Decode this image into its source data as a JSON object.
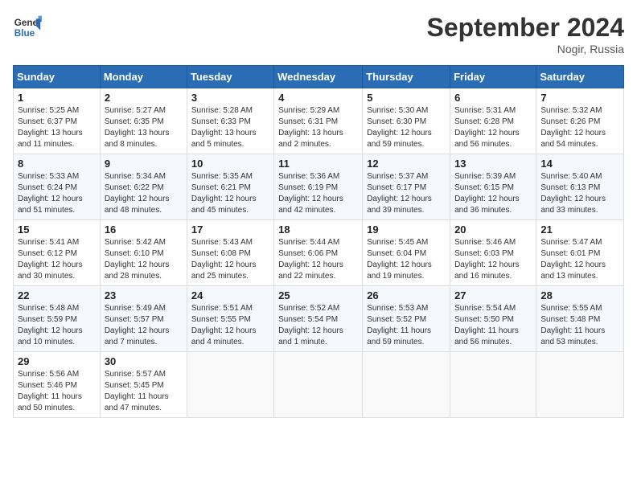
{
  "header": {
    "logo_line1": "General",
    "logo_line2": "Blue",
    "month": "September 2024",
    "location": "Nogir, Russia"
  },
  "weekdays": [
    "Sunday",
    "Monday",
    "Tuesday",
    "Wednesday",
    "Thursday",
    "Friday",
    "Saturday"
  ],
  "weeks": [
    [
      {
        "day": 1,
        "sunrise": "5:25 AM",
        "sunset": "6:37 PM",
        "daylight": "13 hours and 11 minutes."
      },
      {
        "day": 2,
        "sunrise": "5:27 AM",
        "sunset": "6:35 PM",
        "daylight": "13 hours and 8 minutes."
      },
      {
        "day": 3,
        "sunrise": "5:28 AM",
        "sunset": "6:33 PM",
        "daylight": "13 hours and 5 minutes."
      },
      {
        "day": 4,
        "sunrise": "5:29 AM",
        "sunset": "6:31 PM",
        "daylight": "13 hours and 2 minutes."
      },
      {
        "day": 5,
        "sunrise": "5:30 AM",
        "sunset": "6:30 PM",
        "daylight": "12 hours and 59 minutes."
      },
      {
        "day": 6,
        "sunrise": "5:31 AM",
        "sunset": "6:28 PM",
        "daylight": "12 hours and 56 minutes."
      },
      {
        "day": 7,
        "sunrise": "5:32 AM",
        "sunset": "6:26 PM",
        "daylight": "12 hours and 54 minutes."
      }
    ],
    [
      {
        "day": 8,
        "sunrise": "5:33 AM",
        "sunset": "6:24 PM",
        "daylight": "12 hours and 51 minutes."
      },
      {
        "day": 9,
        "sunrise": "5:34 AM",
        "sunset": "6:22 PM",
        "daylight": "12 hours and 48 minutes."
      },
      {
        "day": 10,
        "sunrise": "5:35 AM",
        "sunset": "6:21 PM",
        "daylight": "12 hours and 45 minutes."
      },
      {
        "day": 11,
        "sunrise": "5:36 AM",
        "sunset": "6:19 PM",
        "daylight": "12 hours and 42 minutes."
      },
      {
        "day": 12,
        "sunrise": "5:37 AM",
        "sunset": "6:17 PM",
        "daylight": "12 hours and 39 minutes."
      },
      {
        "day": 13,
        "sunrise": "5:39 AM",
        "sunset": "6:15 PM",
        "daylight": "12 hours and 36 minutes."
      },
      {
        "day": 14,
        "sunrise": "5:40 AM",
        "sunset": "6:13 PM",
        "daylight": "12 hours and 33 minutes."
      }
    ],
    [
      {
        "day": 15,
        "sunrise": "5:41 AM",
        "sunset": "6:12 PM",
        "daylight": "12 hours and 30 minutes."
      },
      {
        "day": 16,
        "sunrise": "5:42 AM",
        "sunset": "6:10 PM",
        "daylight": "12 hours and 28 minutes."
      },
      {
        "day": 17,
        "sunrise": "5:43 AM",
        "sunset": "6:08 PM",
        "daylight": "12 hours and 25 minutes."
      },
      {
        "day": 18,
        "sunrise": "5:44 AM",
        "sunset": "6:06 PM",
        "daylight": "12 hours and 22 minutes."
      },
      {
        "day": 19,
        "sunrise": "5:45 AM",
        "sunset": "6:04 PM",
        "daylight": "12 hours and 19 minutes."
      },
      {
        "day": 20,
        "sunrise": "5:46 AM",
        "sunset": "6:03 PM",
        "daylight": "12 hours and 16 minutes."
      },
      {
        "day": 21,
        "sunrise": "5:47 AM",
        "sunset": "6:01 PM",
        "daylight": "12 hours and 13 minutes."
      }
    ],
    [
      {
        "day": 22,
        "sunrise": "5:48 AM",
        "sunset": "5:59 PM",
        "daylight": "12 hours and 10 minutes."
      },
      {
        "day": 23,
        "sunrise": "5:49 AM",
        "sunset": "5:57 PM",
        "daylight": "12 hours and 7 minutes."
      },
      {
        "day": 24,
        "sunrise": "5:51 AM",
        "sunset": "5:55 PM",
        "daylight": "12 hours and 4 minutes."
      },
      {
        "day": 25,
        "sunrise": "5:52 AM",
        "sunset": "5:54 PM",
        "daylight": "12 hours and 1 minute."
      },
      {
        "day": 26,
        "sunrise": "5:53 AM",
        "sunset": "5:52 PM",
        "daylight": "11 hours and 59 minutes."
      },
      {
        "day": 27,
        "sunrise": "5:54 AM",
        "sunset": "5:50 PM",
        "daylight": "11 hours and 56 minutes."
      },
      {
        "day": 28,
        "sunrise": "5:55 AM",
        "sunset": "5:48 PM",
        "daylight": "11 hours and 53 minutes."
      }
    ],
    [
      {
        "day": 29,
        "sunrise": "5:56 AM",
        "sunset": "5:46 PM",
        "daylight": "11 hours and 50 minutes."
      },
      {
        "day": 30,
        "sunrise": "5:57 AM",
        "sunset": "5:45 PM",
        "daylight": "11 hours and 47 minutes."
      },
      null,
      null,
      null,
      null,
      null
    ]
  ]
}
